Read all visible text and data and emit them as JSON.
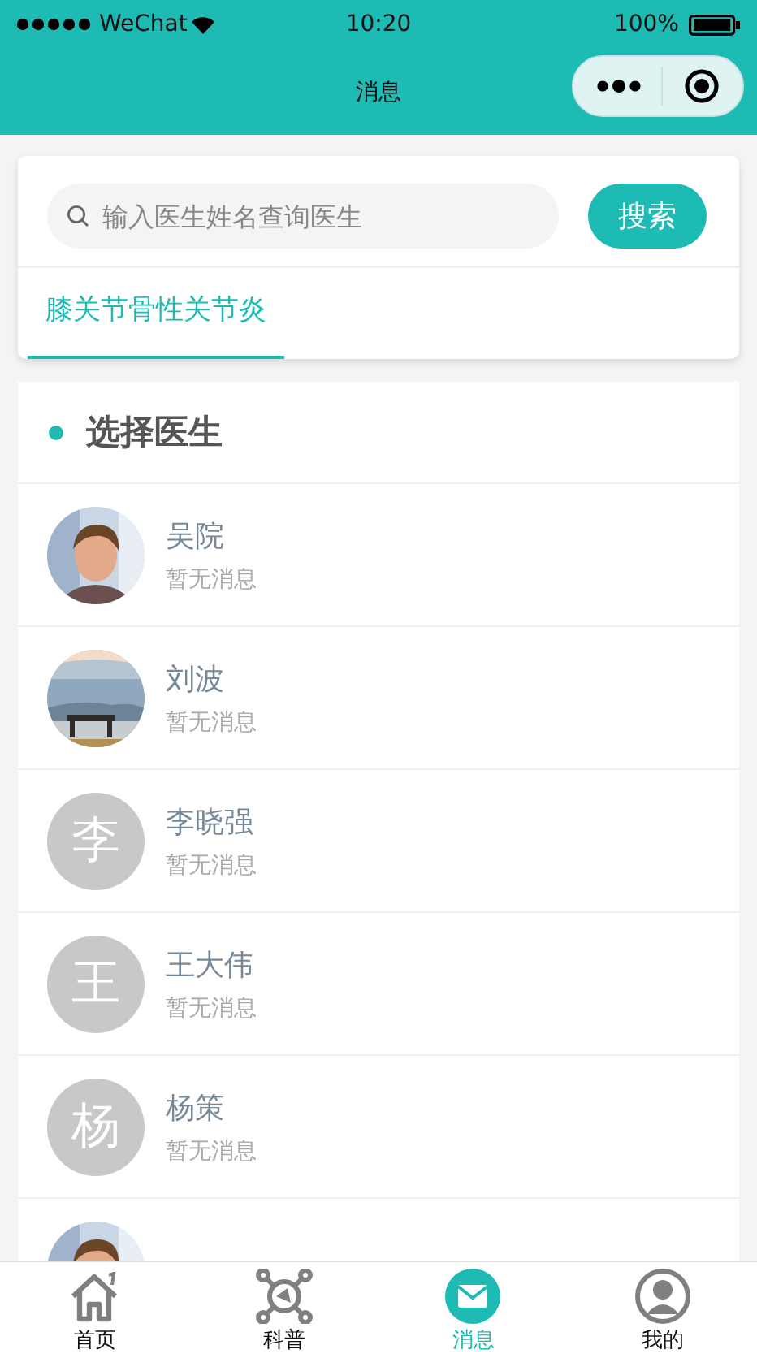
{
  "status_bar": {
    "carrier": "WeChat",
    "time": "10:20",
    "battery": "100%"
  },
  "nav": {
    "title": "消息"
  },
  "search": {
    "placeholder": "输入医生姓名查询医生",
    "button": "搜索"
  },
  "tabs": [
    {
      "label": "膝关节骨性关节炎",
      "selected": true
    }
  ],
  "section": {
    "title": "选择医生"
  },
  "doctors": [
    {
      "name": "吴院",
      "status": "暂无消息",
      "avatar": {
        "kind": "person"
      }
    },
    {
      "name": "刘波",
      "status": "暂无消息"
    },
    {
      "name": "李晓强",
      "status": "暂无消息",
      "avatar": {
        "kind": "initial",
        "text": "李"
      }
    },
    {
      "name": "王大伟",
      "status": "暂无消息",
      "avatar": {
        "kind": "initial",
        "text": "王"
      }
    },
    {
      "name": "杨策",
      "status": "暂无消息",
      "avatar": {
        "kind": "initial",
        "text": "杨"
      }
    },
    {
      "avatar": {
        "kind": "person"
      }
    }
  ],
  "tab_bar": [
    {
      "label": "首页",
      "selected": false
    },
    {
      "label": "科普",
      "selected": false
    },
    {
      "label": "消息",
      "selected": true
    },
    {
      "label": "我的",
      "selected": false
    }
  ]
}
